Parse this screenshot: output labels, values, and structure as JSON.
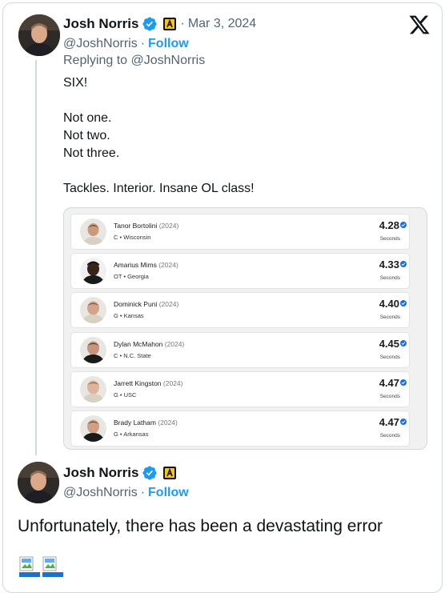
{
  "first_tweet": {
    "author_name": "Josh Norris",
    "date_sep": "·",
    "date": "Mar 3, 2024",
    "handle": "@JoshNorris",
    "follow_sep": "·",
    "follow_label": "Follow",
    "replying_to": "Replying to @JoshNorris",
    "text_lines": [
      "SIX!",
      "",
      "Not one.",
      "Not two.",
      "Not three.",
      "",
      "Tackles. Interior. Insane OL class!"
    ]
  },
  "media_rows": [
    {
      "name": "Tanor Bortolini",
      "year": "(2024)",
      "position": "C • Wisconsin",
      "time": "4.28",
      "unit": "Seconds"
    },
    {
      "name": "Amarius Mims",
      "year": "(2024)",
      "position": "OT • Georgia",
      "time": "4.33",
      "unit": "Seconds"
    },
    {
      "name": "Dominick Puni",
      "year": "(2024)",
      "position": "G • Kansas",
      "time": "4.40",
      "unit": "Seconds"
    },
    {
      "name": "Dylan McMahon",
      "year": "(2024)",
      "position": "C • N.C. State",
      "time": "4.45",
      "unit": "Seconds"
    },
    {
      "name": "Jarrett Kingston",
      "year": "(2024)",
      "position": "G • USC",
      "time": "4.47",
      "unit": "Seconds"
    },
    {
      "name": "Brady Latham",
      "year": "(2024)",
      "position": "G • Arkansas",
      "time": "4.47",
      "unit": "Seconds"
    }
  ],
  "second_tweet": {
    "author_name": "Josh Norris",
    "handle": "@JoshNorris",
    "follow_sep": "·",
    "follow_label": "Follow",
    "text": "Unfortunately, there has been a devastating error"
  },
  "icons": {
    "verified": "verified-badge-icon",
    "affiliate": "affiliate-badge-icon",
    "platform": "x-logo-icon",
    "broken_image": "broken-image-icon"
  },
  "colors": {
    "accent": "#1d9bf0",
    "text": "#0f1419",
    "secondary": "#536471",
    "border": "#cfd9de"
  }
}
